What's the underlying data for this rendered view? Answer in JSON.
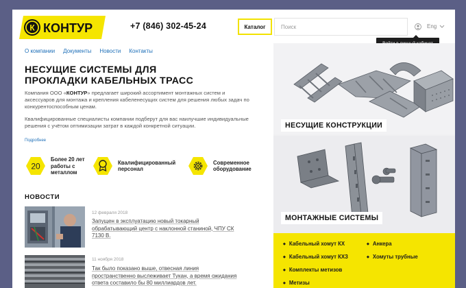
{
  "header": {
    "logo_text": "КОНТУР",
    "phone": "+7 (846) 302-45-24",
    "catalog_label": "Каталог",
    "search_placeholder": "Поиск",
    "language": "Eng",
    "login_tooltip": "Войти в личный кабинет"
  },
  "nav": {
    "items": [
      "О компании",
      "Документы",
      "Новости",
      "Контакты"
    ]
  },
  "intro": {
    "title_line1": "НЕСУЩИЕ СИСТЕМЫ ДЛЯ",
    "title_line2": "ПРОКЛАДКИ КАБЕЛЬНЫХ ТРАСС",
    "p1_before": "Компания ООО «",
    "p1_brand": "КОНТУР",
    "p1_after": "» предлагает широкий ассортимент монтажных систем и аксессуаров для монтажа и крепления кабеленесущих систем для решения любых задач по конкурентоспособным ценам.",
    "p2": "Квалифицированные специалисты компании подберут для вас наилучшие индивидуальные решения с учётом оптимизации затрат в каждой конкретной ситуации.",
    "more_link": "Подробнее"
  },
  "features": [
    {
      "icon": "20",
      "line1": "Более 20 лет",
      "line2": "работы с",
      "line3": "металлом"
    },
    {
      "icon": "medal-icon",
      "line1": "Квалифицированный",
      "line2": "персонал",
      "line3": ""
    },
    {
      "icon": "gear-icon",
      "line1": "Современное",
      "line2": "оборудование",
      "line3": ""
    }
  ],
  "news": {
    "title": "НОВОСТИ",
    "items": [
      {
        "date": "12 февраля 2018",
        "line1": "Запущен в эксплуатацию новый токарный",
        "line2": "обрабатывающий центр с наклонной станиной, ЧПУ СК",
        "line3": "7130 В."
      },
      {
        "date": "11 ноября 2018",
        "line1": "Так было показано выше, отвесная линия",
        "line2": "пространственно выслеживает Тукан, а время ожидания",
        "line3": "ответа составило бы 80 миллиардов лет."
      }
    ]
  },
  "catalog": {
    "category1": "НЕСУЩИЕ КОНСТРУКЦИИ",
    "category2": "МОНТАЖНЫЕ СИСТЕМЫ",
    "links_left": [
      "Кабельный хомут КХ",
      "Кабельный хомут КХЗ",
      "Комплекты метизов",
      "Метизы"
    ],
    "links_right": [
      "Анкера",
      "Хомуты трубные"
    ]
  },
  "colors": {
    "accent": "#f5e500",
    "link": "#1d6fb8",
    "dark": "#1e1e1e"
  }
}
